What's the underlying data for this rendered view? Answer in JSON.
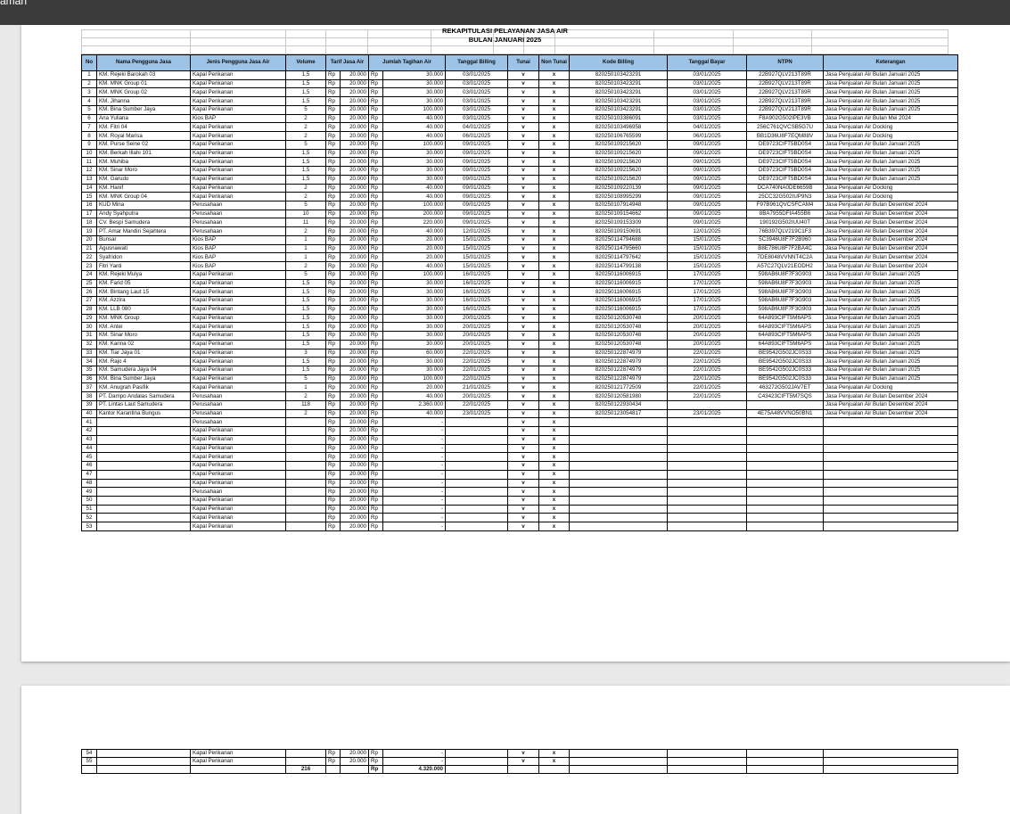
{
  "window": {
    "title": "aman"
  },
  "report": {
    "title": "REKAPITULASI PELAYANAN JASA AIR",
    "subtitle": "BULAN JANUARI 2025"
  },
  "columns": [
    "No",
    "Nama Pengguna Jasa",
    "Jenis Pengguna Jasa Air",
    "Volume",
    "Tarif Jasa Air",
    "Jumlah Tagihan Air",
    "Tanggal Billing",
    "Tunai",
    "Non Tunai",
    "Kode Billing",
    "Tanggal Bayar",
    "NTPN",
    "Keterangan"
  ],
  "rows": [
    [
      "1",
      "KM. Rejeki Barokah 03",
      "Kapal Perikanan",
      "1,5",
      "Rp",
      "20.000",
      "Rp",
      "30.000",
      "03/01/2025",
      "v",
      "x",
      "820250103423291",
      "03/01/2025",
      "22B927QLV213T89R",
      "Jasa Penjualan Air Bulan Januari 2025"
    ],
    [
      "2",
      "KM. MNK Group 01",
      "Kapal Perikanan",
      "1,5",
      "Rp",
      "20.000",
      "Rp",
      "30.000",
      "03/01/2025",
      "v",
      "x",
      "820250103423291",
      "03/01/2025",
      "22B927QLV213T89R",
      "Jasa Penjualan Air Bulan Januari 2025"
    ],
    [
      "3",
      "KM. MNK Group 02",
      "Kapal Perikanan",
      "1,5",
      "Rp",
      "20.000",
      "Rp",
      "30.000",
      "03/01/2025",
      "v",
      "x",
      "820250103423291",
      "03/01/2025",
      "22B927QLV213T89R",
      "Jasa Penjualan Air Bulan Januari 2025"
    ],
    [
      "4",
      "KM. Jihanna",
      "Kapal Perikanan",
      "1,5",
      "Rp",
      "20.000",
      "Rp",
      "30.000",
      "03/01/2025",
      "v",
      "x",
      "820250103423291",
      "03/01/2025",
      "22B927QLV213T89R",
      "Jasa Penjualan Air Bulan Januari 2025"
    ],
    [
      "5",
      "KM. Bina Sumber Jaya",
      "Kapal Perikanan",
      "5",
      "Rp",
      "20.000",
      "Rp",
      "100.000",
      "03/01/2025",
      "v",
      "x",
      "820250103423291",
      "03/01/2025",
      "22B927QLV213T89R",
      "Jasa Penjualan Air Bulan Januari 2025"
    ],
    [
      "6",
      "Ana Yuliana",
      "Kios BAP",
      "2",
      "Rp",
      "20.000",
      "Rp",
      "40.000",
      "03/01/2025",
      "v",
      "x",
      "820250103386091",
      "03/01/2025",
      "F8A902G502IPE3VB",
      "Jasa Penjualan Air Bulan Mei 2024"
    ],
    [
      "7",
      "KM. Fitri 04",
      "Kapal Perikanan",
      "2",
      "Rp",
      "20.000",
      "Rp",
      "40.000",
      "04/01/2025",
      "v",
      "x",
      "820250103496958",
      "04/01/2025",
      "256C761QVCSB5G7U",
      "Jasa Penjualan Air Docking"
    ],
    [
      "8",
      "KM. Royal Marisa",
      "Kapal Perikanan",
      "2",
      "Rp",
      "20.000",
      "Rp",
      "40.000",
      "06/01/2025",
      "v",
      "x",
      "820250106765599",
      "06/01/2025",
      "BB1D36U8F7EQM88V",
      "Jasa Penjualan Air Docking"
    ],
    [
      "9",
      "KM. Purse Seine 02",
      "Kapal Perikanan",
      "5",
      "Rp",
      "20.000",
      "Rp",
      "100.000",
      "09/01/2025",
      "v",
      "x",
      "820250109215620",
      "09/01/2025",
      "DE9723CIFT5BD0S4",
      "Jasa Penjualan Air Bulan Januari 2025"
    ],
    [
      "10",
      "KM. Berkah Illahi 101",
      "Kapal Perikanan",
      "1,5",
      "Rp",
      "20.000",
      "Rp",
      "30.000",
      "09/01/2025",
      "v",
      "x",
      "820250109215620",
      "09/01/2025",
      "DE9723CIFT5BD0S4",
      "Jasa Penjualan Air Bulan Januari 2025"
    ],
    [
      "11",
      "KM. Muhiba",
      "Kapal Perikanan",
      "1,5",
      "Rp",
      "20.000",
      "Rp",
      "30.000",
      "09/01/2025",
      "v",
      "x",
      "820250109215620",
      "09/01/2025",
      "DE9723CIFT5BD0S4",
      "Jasa Penjualan Air Bulan Januari 2025"
    ],
    [
      "12",
      "KM. Sinar Moro",
      "Kapal Perikanan",
      "1,5",
      "Rp",
      "20.000",
      "Rp",
      "30.000",
      "09/01/2025",
      "v",
      "x",
      "820250109215620",
      "09/01/2025",
      "DE9723CIFT5BD0S4",
      "Jasa Penjualan Air Bulan Januari 2025"
    ],
    [
      "13",
      "KM. Garudo",
      "Kapal Perikanan",
      "1,5",
      "Rp",
      "20.000",
      "Rp",
      "30.000",
      "09/01/2025",
      "v",
      "x",
      "820250109215620",
      "09/01/2025",
      "DE9723CIFT5BD0S4",
      "Jasa Penjualan Air Bulan Januari 2025"
    ],
    [
      "14",
      "KM. Hanif",
      "Kapal Perikanan",
      "2",
      "Rp",
      "20.000",
      "Rp",
      "40.000",
      "09/01/2025",
      "v",
      "x",
      "820250109220139",
      "09/01/2025",
      "DCA740NA0DE6659B",
      "Jasa Penjualan Air Docking"
    ],
    [
      "15",
      "KM. MNK Group 04",
      "Kapal Perikanan",
      "2",
      "Rp",
      "20.000",
      "Rp",
      "40.000",
      "09/01/2025",
      "v",
      "x",
      "820250108995299",
      "09/01/2025",
      "25CC32G502IUP9N3",
      "Jasa Penjualan Air Docking"
    ],
    [
      "16",
      "KUD Mina",
      "Perusahaan",
      "5",
      "Rp",
      "20.000",
      "Rp",
      "100.000",
      "09/01/2025",
      "v",
      "x",
      "820250107914948",
      "09/01/2025",
      "F97B961QVCSFCAM4",
      "Jasa Penjualan Air Bulan Desember 2024"
    ],
    [
      "17",
      "Andy Syahputra",
      "Perusahaan",
      "10",
      "Rp",
      "20.000",
      "Rp",
      "200.000",
      "09/01/2025",
      "v",
      "x",
      "820250109154662",
      "09/01/2025",
      "8BA7955DFIA455B6",
      "Jasa Penjualan Air Bulan Desember 2024"
    ],
    [
      "18",
      "CV. Bespi Samudera",
      "Perusahaan",
      "11",
      "Rp",
      "20.000",
      "Rp",
      "220.000",
      "09/01/2025",
      "v",
      "x",
      "820250109153309",
      "09/01/2025",
      "190192G502IUU40T",
      "Jasa Penjualan Air Bulan Desember 2024"
    ],
    [
      "19",
      "PT. Amar Mandiri Sejahtera",
      "Perusahaan",
      "2",
      "Rp",
      "20.000",
      "Rp",
      "40.000",
      "12/01/2025",
      "v",
      "x",
      "820250109150691",
      "12/01/2025",
      "76B397QLV219C1F3",
      "Jasa Penjualan Air Bulan Desember 2024"
    ],
    [
      "20",
      "Bunsar",
      "Kios BAP",
      "1",
      "Rp",
      "20.000",
      "Rp",
      "20.000",
      "15/01/2025",
      "v",
      "x",
      "820250114794688",
      "15/01/2025",
      "5C3946U8F7F2B960",
      "Jasa Penjualan Air Bulan Desember 2024"
    ],
    [
      "21",
      "Agusnawati",
      "Kios BAP",
      "1",
      "Rp",
      "20.000",
      "Rp",
      "20.000",
      "15/01/2025",
      "v",
      "x",
      "820250114795660",
      "15/01/2025",
      "B8E786U8F7F2BA4C",
      "Jasa Penjualan Air Bulan Desember 2024"
    ],
    [
      "22",
      "Syafridon",
      "Kios BAP",
      "1",
      "Rp",
      "20.000",
      "Rp",
      "20.000",
      "15/01/2025",
      "v",
      "x",
      "820250114797642",
      "15/01/2025",
      "7DE8048VVNNT4C2A",
      "Jasa Penjualan Air Bulan Desember 2024"
    ],
    [
      "23",
      "Fitri Yanti",
      "Kios BAP",
      "2",
      "Rp",
      "20.000",
      "Rp",
      "40.000",
      "15/01/2025",
      "v",
      "x",
      "820250114799138",
      "15/01/2025",
      "A57C27QLV21EODH2",
      "Jasa Penjualan Air Bulan Desember 2024"
    ],
    [
      "24",
      "KM. Rejeki Mulya",
      "Kapal Perikanan",
      "5",
      "Rp",
      "20.000",
      "Rp",
      "100.000",
      "16/01/2025",
      "v",
      "x",
      "820250116006915",
      "17/01/2025",
      "598AB6U8F7F3G903",
      "Jasa Penjualan Air Bulan Januari 2025"
    ],
    [
      "25",
      "KM. Farid 05",
      "Kapal Perikanan",
      "1,5",
      "Rp",
      "20.000",
      "Rp",
      "30.000",
      "16/01/2025",
      "v",
      "x",
      "820250116006915",
      "17/01/2025",
      "598AB6U8F7F3G903",
      "Jasa Penjualan Air Bulan Januari 2025"
    ],
    [
      "26",
      "KM. Bintang Laut 15",
      "Kapal Perikanan",
      "1,5",
      "Rp",
      "20.000",
      "Rp",
      "30.000",
      "16/01/2025",
      "v",
      "x",
      "820250116006915",
      "17/01/2025",
      "598AB6U8F7F3G903",
      "Jasa Penjualan Air Bulan Januari 2025"
    ],
    [
      "27",
      "KM. Azzira",
      "Kapal Perikanan",
      "1,5",
      "Rp",
      "20.000",
      "Rp",
      "30.000",
      "16/01/2025",
      "v",
      "x",
      "820250116006915",
      "17/01/2025",
      "598AB6U8F7F3G903",
      "Jasa Penjualan Air Bulan Januari 2025"
    ],
    [
      "28",
      "KM. LLB 080",
      "Kapal Perikanan",
      "1,5",
      "Rp",
      "20.000",
      "Rp",
      "30.000",
      "16/01/2025",
      "v",
      "x",
      "820250116006915",
      "17/01/2025",
      "598AB6U8F7F3G903",
      "Jasa Penjualan Air Bulan Januari 2025"
    ],
    [
      "29",
      "KM. MNK Group",
      "Kapal Perikanan",
      "1,5",
      "Rp",
      "20.000",
      "Rp",
      "30.000",
      "20/01/2025",
      "v",
      "x",
      "820250120530748",
      "20/01/2025",
      "64A893CIFT5M6APS",
      "Jasa Penjualan Air Bulan Januari 2025"
    ],
    [
      "30",
      "KM. Antei",
      "Kapal Perikanan",
      "1,5",
      "Rp",
      "20.000",
      "Rp",
      "30.000",
      "20/01/2025",
      "v",
      "x",
      "820250120530748",
      "20/01/2025",
      "64A893CIFT5M6APS",
      "Jasa Penjualan Air Bulan Januari 2025"
    ],
    [
      "31",
      "KM. Sinar Moro",
      "Kapal Perikanan",
      "1,5",
      "Rp",
      "20.000",
      "Rp",
      "30.000",
      "20/01/2025",
      "v",
      "x",
      "820250120530748",
      "20/01/2025",
      "64A893CIFT5M6APS",
      "Jasa Penjualan Air Bulan Januari 2025"
    ],
    [
      "32",
      "KM. Karina 02",
      "Kapal Perikanan",
      "1,5",
      "Rp",
      "20.000",
      "Rp",
      "30.000",
      "20/01/2025",
      "v",
      "x",
      "820250120530748",
      "20/01/2025",
      "64A893CIFT5M6APS",
      "Jasa Penjualan Air Bulan Januari 2025"
    ],
    [
      "33",
      "KM. Tiar Jaya 01",
      "Kapal Perikanan",
      "3",
      "Rp",
      "20.000",
      "Rp",
      "60.000",
      "22/01/2025",
      "v",
      "x",
      "820250122874979",
      "22/01/2025",
      "BE9542G502JC0S33",
      "Jasa Penjualan Air Bulan Januari 2025"
    ],
    [
      "34",
      "KM. Rajo 4",
      "Kapal Perikanan",
      "1,5",
      "Rp",
      "20.000",
      "Rp",
      "30.000",
      "22/01/2025",
      "v",
      "x",
      "820250122874979",
      "22/01/2025",
      "BE9542G502JC0S33",
      "Jasa Penjualan Air Bulan Januari 2025"
    ],
    [
      "35",
      "KM. Samudera Jaya 04",
      "Kapal Perikanan",
      "1,5",
      "Rp",
      "20.000",
      "Rp",
      "30.000",
      "22/01/2025",
      "v",
      "x",
      "820250122874979",
      "22/01/2025",
      "BE9542G502JC0S33",
      "Jasa Penjualan Air Bulan Januari 2025"
    ],
    [
      "36",
      "KM. Bina Sumber Jaya",
      "Kapal Perikanan",
      "5",
      "Rp",
      "20.000",
      "Rp",
      "100.000",
      "22/01/2025",
      "v",
      "x",
      "820250122874979",
      "22/01/2025",
      "BE9542G502JC0S33",
      "Jasa Penjualan Air Bulan Januari 2025"
    ],
    [
      "37",
      "KM. Anugrah Pasifik",
      "Kapal Perikanan",
      "1",
      "Rp",
      "20.000",
      "Rp",
      "20.000",
      "21/01/2025",
      "v",
      "x",
      "820250121772509",
      "22/01/2025",
      "463272G502JAV7ET",
      "Jasa Penjualan Air Docking"
    ],
    [
      "38",
      "PT. Dampo Andalas Samudera",
      "Perusahaan",
      "2",
      "Rp",
      "20.000",
      "Rp",
      "40.000",
      "20/01/2025",
      "v",
      "x",
      "820250120581980",
      "22/01/2025",
      "C43423CIFT5M7SQS",
      "Jasa Penjualan Air Bulan Desember 2024"
    ],
    [
      "39",
      "PT. Lintas Laut Samudera",
      "Perusahaan",
      "118",
      "Rp",
      "20.000",
      "Rp",
      "2.360.000",
      "22/01/2025",
      "v",
      "x",
      "820250122930434",
      "",
      "",
      "Jasa Penjualan Air Bulan Desember 2024"
    ],
    [
      "40",
      "Kantor Karantina Bungus",
      "Perusahaan",
      "2",
      "Rp",
      "20.000",
      "Rp",
      "40.000",
      "23/01/2025",
      "v",
      "x",
      "820250123054817",
      "23/01/2025",
      "4E75A48VVNO50BN1",
      "Jasa Penjualan Air Bulan Desember 2024"
    ],
    [
      "41",
      "",
      "Perusahaan",
      "",
      "Rp",
      "20.000",
      "Rp",
      "-",
      "",
      "v",
      "x",
      "",
      "",
      "",
      ""
    ],
    [
      "42",
      "",
      "Kapal Perikanan",
      "",
      "Rp",
      "20.000",
      "Rp",
      "-",
      "",
      "v",
      "x",
      "",
      "",
      "",
      ""
    ],
    [
      "43",
      "",
      "Kapal Perikanan",
      "",
      "Rp",
      "20.000",
      "Rp",
      "-",
      "",
      "v",
      "x",
      "",
      "",
      "",
      ""
    ],
    [
      "44",
      "",
      "Kapal Perikanan",
      "",
      "Rp",
      "20.000",
      "Rp",
      "-",
      "",
      "v",
      "x",
      "",
      "",
      "",
      ""
    ],
    [
      "45",
      "",
      "Kapal Perikanan",
      "",
      "Rp",
      "20.000",
      "Rp",
      "-",
      "",
      "v",
      "x",
      "",
      "",
      "",
      ""
    ],
    [
      "46",
      "",
      "Kapal Perikanan",
      "",
      "Rp",
      "20.000",
      "Rp",
      "-",
      "",
      "v",
      "x",
      "",
      "",
      "",
      ""
    ],
    [
      "47",
      "",
      "Kapal Perikanan",
      "",
      "Rp",
      "20.000",
      "Rp",
      "-",
      "",
      "v",
      "x",
      "",
      "",
      "",
      ""
    ],
    [
      "48",
      "",
      "Kapal Perikanan",
      "",
      "Rp",
      "20.000",
      "Rp",
      "-",
      "",
      "v",
      "x",
      "",
      "",
      "",
      ""
    ],
    [
      "49",
      "",
      "Perusahaan",
      "",
      "Rp",
      "20.000",
      "Rp",
      "-",
      "",
      "v",
      "x",
      "",
      "",
      "",
      ""
    ],
    [
      "50",
      "",
      "Kapal Perikanan",
      "",
      "Rp",
      "20.000",
      "Rp",
      "-",
      "",
      "v",
      "x",
      "",
      "",
      "",
      ""
    ],
    [
      "51",
      "",
      "Kapal Perikanan",
      "",
      "Rp",
      "20.000",
      "Rp",
      "-",
      "",
      "v",
      "x",
      "",
      "",
      "",
      ""
    ],
    [
      "52",
      "",
      "Kapal Perikanan",
      "",
      "Rp",
      "20.000",
      "Rp",
      "-",
      "",
      "v",
      "x",
      "",
      "",
      "",
      ""
    ],
    [
      "53",
      "",
      "Kapal Perikanan",
      "",
      "Rp",
      "20.000",
      "Rp",
      "-",
      "",
      "v",
      "x",
      "",
      "",
      "",
      ""
    ]
  ],
  "rows_page2": [
    [
      "54",
      "",
      "Kapal Perikanan",
      "",
      "Rp",
      "20.000",
      "Rp",
      "-",
      "",
      "v",
      "x",
      "",
      "",
      "",
      ""
    ],
    [
      "55",
      "",
      "Kapal Perikanan",
      "",
      "Rp",
      "20.000",
      "Rp",
      "-",
      "",
      "v",
      "x",
      "",
      "",
      "",
      ""
    ]
  ],
  "totals": {
    "volume": "216",
    "currency": "Rp",
    "amount": "4.320.000"
  }
}
